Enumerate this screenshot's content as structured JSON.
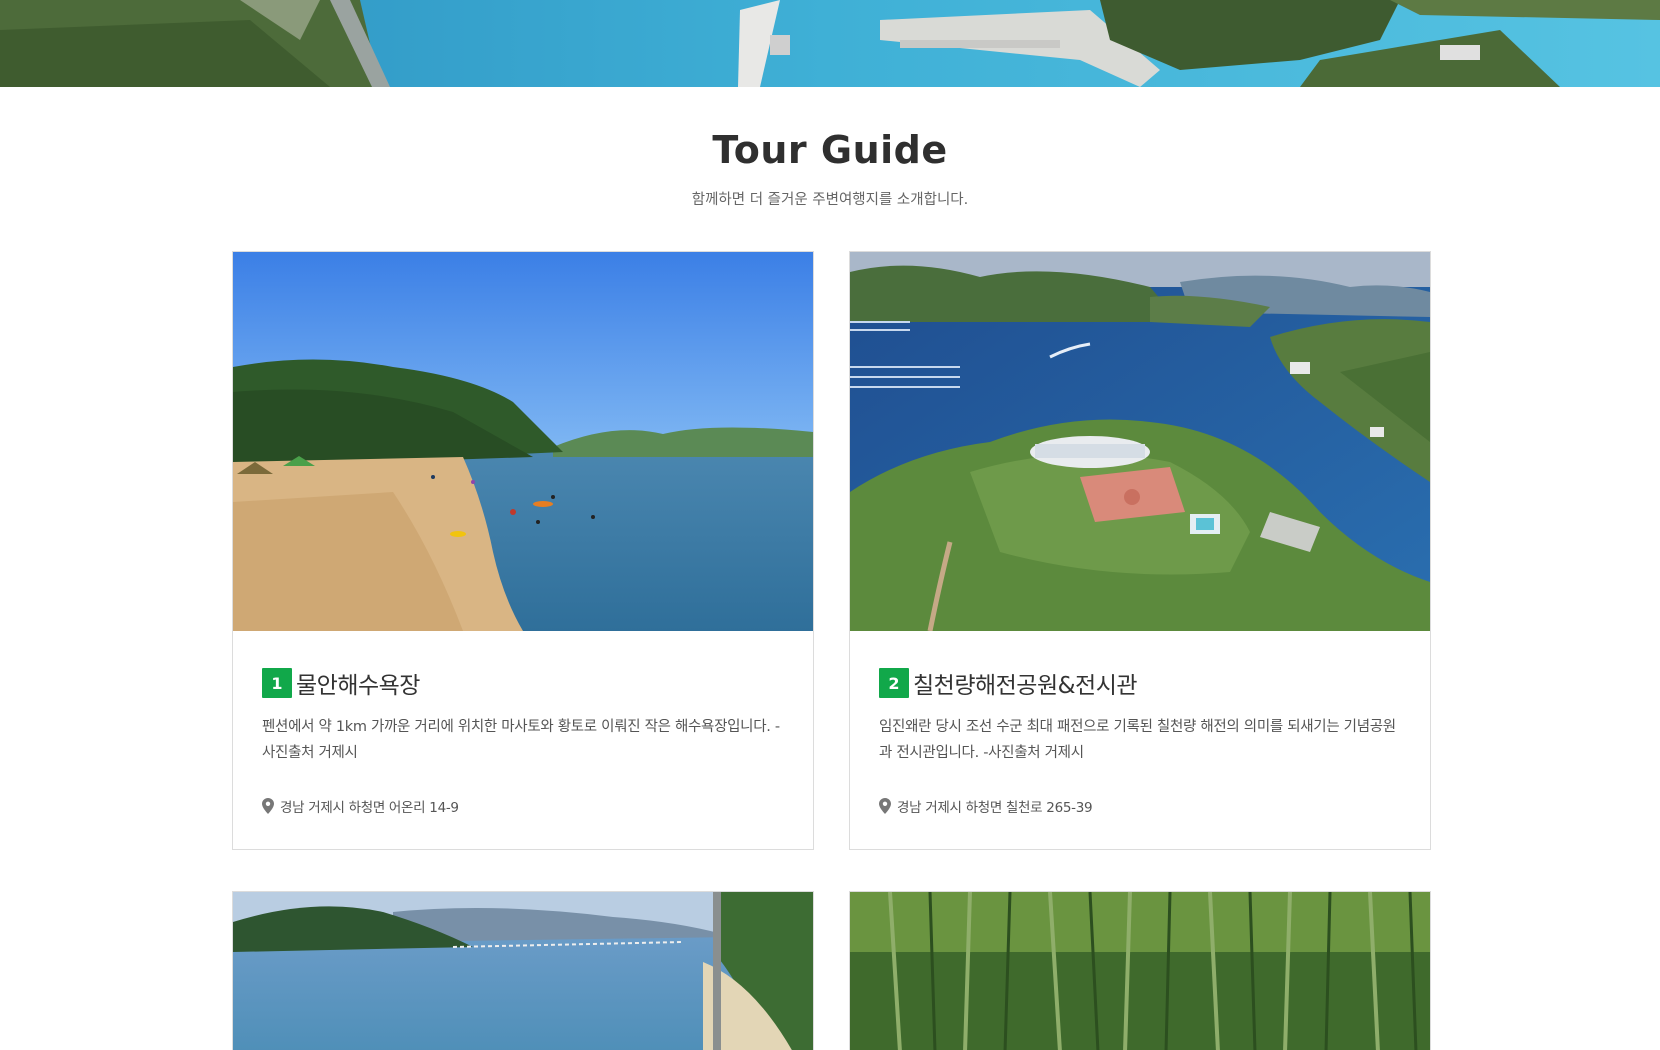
{
  "section": {
    "title": "Tour Guide",
    "subtitle": "함께하면 더 즐거운 주변여행지를 소개합니다."
  },
  "cards": [
    {
      "number": "1",
      "title": "물안해수욕장",
      "description": "펜션에서 약 1km 가까운 거리에 위치한 마사토와 황토로 이뤄진 작은 해수욕장입니다. -사진출처 거제시",
      "address": "경남 거제시 하청면 어온리 14-9",
      "address_icon": "map-pin-icon"
    },
    {
      "number": "2",
      "title": "칠천량해전공원&전시관",
      "description": "임진왜란 당시 조선 수군 최대 패전으로 기록된 칠천량 해전의 의미를 되새기는 기념공원과 전시관입니다. -사진출처 거제시",
      "address": "경남 거제시 하청면 칠천로 265-39",
      "address_icon": "map-pin-icon"
    }
  ],
  "colors": {
    "badge": "#11a84a",
    "title": "#2f2f2f",
    "border": "#dcdcdc"
  }
}
